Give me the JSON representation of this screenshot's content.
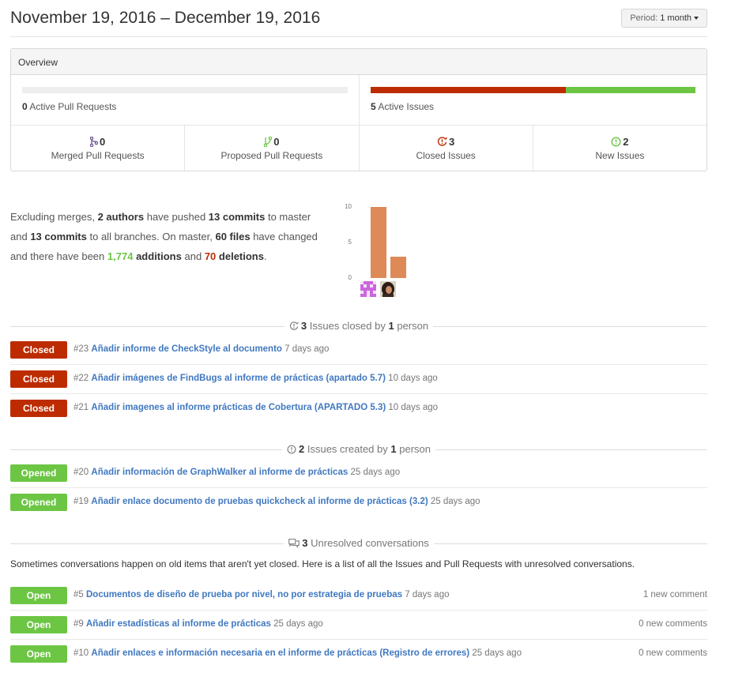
{
  "header": {
    "title": "November 19, 2016 – December 19, 2016",
    "period_label": "Period:",
    "period_value": "1 month"
  },
  "overview": {
    "title": "Overview",
    "active_prs": {
      "count": "0",
      "label": "Active Pull Requests"
    },
    "active_issues": {
      "count": "5",
      "label": "Active Issues",
      "closed_fraction": 0.6,
      "new_fraction": 0.4
    },
    "stats": [
      {
        "icon": "merged-pr-icon",
        "count": "0",
        "label": "Merged Pull Requests"
      },
      {
        "icon": "proposed-pr-icon",
        "count": "0",
        "label": "Proposed Pull Requests"
      },
      {
        "icon": "closed-issue-icon",
        "count": "3",
        "label": "Closed Issues"
      },
      {
        "icon": "new-issue-icon",
        "count": "2",
        "label": "New Issues"
      }
    ]
  },
  "summary": {
    "p1": "Excluding merges,",
    "authors": "2 authors",
    "p2": "have pushed",
    "commits_master": "13 commits",
    "p3": "to master and",
    "commits_all": "13 commits",
    "p4": "to all branches. On master,",
    "files": "60 files",
    "p5": "have changed and there have been",
    "additions_num": "1,774",
    "additions_word": "additions",
    "p6": "and",
    "deletions_num": "70",
    "deletions_word": "deletions",
    "p7": "."
  },
  "chart_data": {
    "type": "bar",
    "categories": [
      "author-1",
      "author-2"
    ],
    "values": [
      10,
      3
    ],
    "yticks": [
      "10",
      "5",
      "0"
    ],
    "ylim": [
      0,
      10
    ],
    "bar_color": "#dd8a58"
  },
  "closed_section": {
    "count": "3",
    "text": "Issues closed by",
    "people": "1",
    "people_word": "person",
    "items": [
      {
        "status": "Closed",
        "number": "#23",
        "title": "Añadir informe de CheckStyle al documento",
        "ago": "7 days ago"
      },
      {
        "status": "Closed",
        "number": "#22",
        "title": "Añadir imágenes de FindBugs al informe de prácticas (apartado 5.7)",
        "ago": "10 days ago"
      },
      {
        "status": "Closed",
        "number": "#21",
        "title": "Añadir imagenes al informe prácticas de Cobertura (APARTADO 5.3)",
        "ago": "10 days ago"
      }
    ]
  },
  "created_section": {
    "count": "2",
    "text": "Issues created by",
    "people": "1",
    "people_word": "person",
    "items": [
      {
        "status": "Opened",
        "number": "#20",
        "title": "Añadir información de GraphWalker al informe de prácticas",
        "ago": "25 days ago"
      },
      {
        "status": "Opened",
        "number": "#19",
        "title": "Añadir enlace documento de pruebas quickcheck al informe de prácticas (3.2)",
        "ago": "25 days ago"
      }
    ]
  },
  "conversations_section": {
    "count": "3",
    "text": "Unresolved conversations",
    "note": "Sometimes conversations happen on old items that aren't yet closed. Here is a list of all the Issues and Pull Requests with unresolved conversations.",
    "items": [
      {
        "status": "Open",
        "number": "#5",
        "title": "Documentos de diseño de prueba por nivel, no por estrategia de pruebas",
        "ago": "7 days ago",
        "comments": "1 new comment"
      },
      {
        "status": "Open",
        "number": "#9",
        "title": "Añadir estadísticas al informe de prácticas",
        "ago": "25 days ago",
        "comments": "0 new comments"
      },
      {
        "status": "Open",
        "number": "#10",
        "title": "Añadir enlaces e información necesaria en el informe de prácticas (Registro de errores)",
        "ago": "25 days ago",
        "comments": "0 new comments"
      }
    ]
  },
  "colors": {
    "red": "#bd2c00",
    "green": "#6cc644",
    "link": "#4078c0"
  }
}
